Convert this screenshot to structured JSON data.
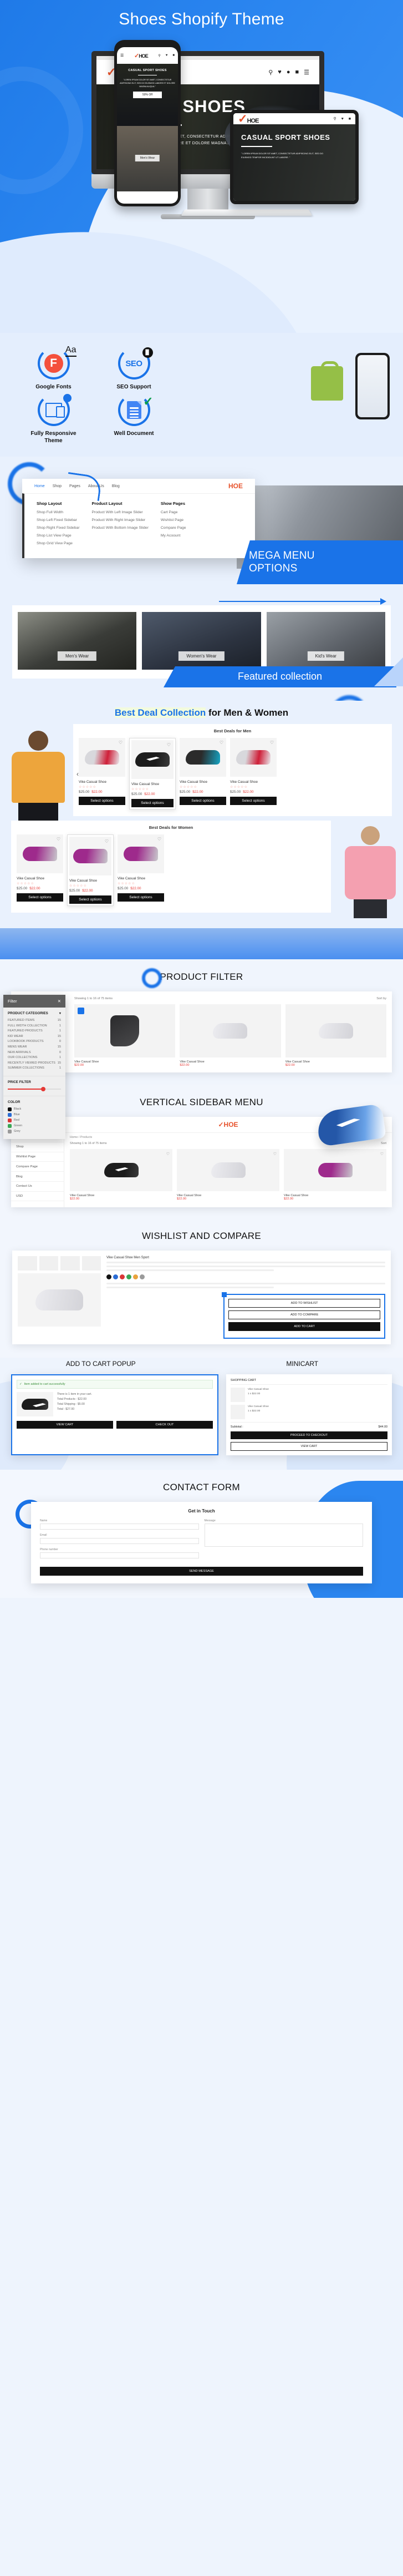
{
  "hero": {
    "title": "Shoes Shopify Theme",
    "desktop": {
      "logo": "HOE",
      "banner_title": "SPORT SHOES",
      "banner_text": "\" LOREM IPSUM DOLOR SIT AMET, CONSECTETUR ADIPISCING ELIT, SED DO EIUSMOD TEMPOR INCIDIDUNT UT LABORE ET DOLORE MAGNA ALIQUA. \"",
      "icons": [
        "search-icon",
        "heart-icon",
        "user-icon",
        "cart-icon",
        "menu-icon"
      ]
    },
    "phone": {
      "banner_title": "CASUAL SPORT SHOES",
      "banner_text": "\"LOREM IPSUM DOLOR SIT AMET, CONSECTETUR ADIPISCING ELIT, SED DO EIUSMOD LABORE ET DOLORE MAGNA ALIQUA.\"",
      "offer": "50% Off",
      "category_tag": "Men's Wear"
    },
    "tablet": {
      "banner_title": "CASUAL SPORT SHOES",
      "banner_text": "\" LOREM IPSUM DOLOR SIT AMET, CONSECTETUR ADIPISCING ELIT, SED DO EIUSMOD TEMPOR INCIDIDUNT UT LABORE. \""
    }
  },
  "features": {
    "items": [
      {
        "label": "Google Fonts",
        "icon": "google-fonts-icon",
        "glyph": "F",
        "aa": "Aa"
      },
      {
        "label": "SEO Support",
        "icon": "seo-icon",
        "glyph": "SEO",
        "badge": "chart-badge-icon"
      },
      {
        "label": "Fully Responsive\nTheme",
        "icon": "responsive-devices-icon"
      },
      {
        "label": "Well Document",
        "icon": "document-check-icon"
      }
    ],
    "shopify_logo": "shopify-bag-icon"
  },
  "mega_menu": {
    "nav": [
      "Home",
      "Shop",
      "Pages",
      "About Us",
      "Blog"
    ],
    "logo": "HOE",
    "columns": [
      {
        "heading": "Shop Layout",
        "links": [
          "Shop Full Width",
          "Shop Left Fixed Sidebar",
          "Shop Right Fixed Sidebar",
          "Shop List View Page",
          "Shop Grid View Page"
        ]
      },
      {
        "heading": "Product Layout",
        "links": [
          "Product With Left Image Slider",
          "Product With Right Image Slider",
          "Product With Bottom Image Slider"
        ]
      },
      {
        "heading": "Show Pages",
        "links": [
          "Cart Page",
          "Wishlist Page",
          "Compare Page",
          "My Acoount"
        ]
      }
    ],
    "label": "MEGA MENU\nOPTIONS"
  },
  "featured_collection": {
    "cells": [
      {
        "tag": "Men's Wear"
      },
      {
        "tag": "Women's Wear"
      },
      {
        "tag": "Kid's Wear"
      }
    ],
    "banner": "Featured collection"
  },
  "best_deal": {
    "title_highlight": "Best Deal Collection",
    "title_rest": " for Men & Women",
    "men": {
      "heading": "Best Deals for Men",
      "products": [
        {
          "name": "Vike Casual Shoe",
          "stars": "☆☆☆☆☆",
          "price": "$25.00",
          "sale": "$22.00",
          "button": "Select options"
        },
        {
          "name": "Vike Casual Shoe",
          "stars": "☆☆☆☆☆",
          "price": "$25.00",
          "sale": "$22.00",
          "button": "Select options"
        },
        {
          "name": "Vike Casual Shoe",
          "stars": "☆☆☆☆☆",
          "price": "$25.00",
          "sale": "$22.00",
          "button": "Select options"
        },
        {
          "name": "Vike Casual Shoe",
          "stars": "☆☆☆☆☆",
          "price": "$25.00",
          "sale": "$22.00",
          "button": "Select options"
        }
      ]
    },
    "women": {
      "heading": "Best Deals for Women",
      "products": [
        {
          "name": "Vike Casual Shoe",
          "stars": "☆☆☆☆☆",
          "price": "$25.00",
          "sale": "$22.00",
          "button": "Select options"
        },
        {
          "name": "Vike Casual Shoe",
          "stars": "☆☆☆☆☆",
          "price": "$25.00",
          "sale": "$22.00",
          "button": "Select options"
        },
        {
          "name": "Vike Casual Shoe",
          "stars": "☆☆☆☆☆",
          "price": "$25.00",
          "sale": "$22.00",
          "button": "Select options"
        }
      ]
    }
  },
  "product_filter": {
    "section_title": "PRODUCT FILTER",
    "panel_title": "Filter",
    "close_icon": "close-icon",
    "categories_heading": "PRODUCT CATEGORIES",
    "categories": [
      {
        "label": "FEATURED ITEMS",
        "count": "15"
      },
      {
        "label": "FULL WIDTH COLLECTION",
        "count": "1"
      },
      {
        "label": "FEATURED PRODUCTS",
        "count": "1"
      },
      {
        "label": "KID WEAR",
        "count": "15"
      },
      {
        "label": "LOOKBOOK PRODUCTS",
        "count": "0"
      },
      {
        "label": "MENS WEAR",
        "count": "15"
      },
      {
        "label": "NEW ARRIVALS",
        "count": "0"
      },
      {
        "label": "OUR COLLECTIONS",
        "count": "1"
      },
      {
        "label": "RECENTLY VIEWED PRODUCTS",
        "count": "15"
      },
      {
        "label": "SUMMER COLLECTIONS",
        "count": "1"
      }
    ],
    "price_heading": "PRICE FILTER",
    "color_heading": "COLOR",
    "colors": [
      {
        "name": "Black",
        "hex": "#111111"
      },
      {
        "name": "Blue",
        "hex": "#2b6cd4"
      },
      {
        "name": "Red",
        "hex": "#d93636"
      },
      {
        "name": "Green",
        "hex": "#3aa655"
      },
      {
        "name": "Grey",
        "hex": "#9a9a9a"
      }
    ],
    "showing_text": "Showing 1 to 16 of 75 items",
    "sort_label": "Sort by",
    "products": [
      {
        "name": "Vike Casual Shoe",
        "price": "$22.00"
      },
      {
        "name": "Vike Casual Shoe",
        "price": "$22.00"
      },
      {
        "name": "Vike Casual Shoe",
        "price": "$22.00"
      }
    ]
  },
  "vertical_sidebar": {
    "section_title": "VERTICAL SIDEBAR MENU",
    "logo": "HOE",
    "currency": "USD",
    "menu": [
      "Home",
      "Shop",
      "Wishlist Page",
      "Compare Page",
      "Blog",
      "Contact Us",
      "USD"
    ],
    "breadcrumb": "Home  /  Products",
    "showing_text": "Showing 1 to 16 of 75 items",
    "sort_label": "Sort by",
    "sort_value": "Sort",
    "products": [
      {
        "name": "Vike Casual Shoe",
        "price": "$22.00"
      },
      {
        "name": "Vike Casual Shoe",
        "price": "$22.00"
      },
      {
        "name": "Vike Casual Shoe",
        "price": "$22.00"
      }
    ]
  },
  "wishlist_compare": {
    "section_title": "WISHLIST AND COMPARE",
    "product_title": "Vike Casual Shoe Men Sport",
    "buttons": [
      "ADD TO WISHLIST",
      "ADD TO COMPARE",
      "ADD TO CART"
    ],
    "swatches": [
      "#111111",
      "#2b6cd4",
      "#d93636",
      "#3aa655",
      "#e8a33d",
      "#9a9a9a"
    ]
  },
  "cart": {
    "popup_title": "ADD TO CART POPUP",
    "minicart_title": "MINICART",
    "popup": {
      "success_text": "Item added to cart successfully",
      "product_name": "Vike Casual Shoe",
      "meta": "There is 1 item in your cart.\nTotal Products : $22.00\nTotal Shipping : $5.00\nTotal : $27.00",
      "buttons": [
        "VIEW CART",
        "CHECK OUT"
      ]
    },
    "minicart": {
      "header": "SHOPPING CART",
      "items": [
        {
          "name": "Vike Casual Shoe",
          "meta": "1 x $22.00"
        },
        {
          "name": "Vike Casual Shoe",
          "meta": "1 x $22.00"
        }
      ],
      "subtotal_label": "Subtotal :",
      "subtotal_value": "$44.00",
      "buttons": [
        "PROCEED TO CHECKOUT",
        "VIEW CART"
      ]
    }
  },
  "contact": {
    "section_title": "CONTACT FORM",
    "heading": "Get in Touch",
    "fields": [
      {
        "label": "Name",
        "placeholder": ""
      },
      {
        "label": "Email",
        "placeholder": ""
      },
      {
        "label": "Phone number",
        "placeholder": ""
      },
      {
        "label": "Message",
        "placeholder": ""
      }
    ],
    "submit": "SEND MESSAGE"
  },
  "colors": {
    "brand_blue": "#1a73e8",
    "hero_blue": "#2b86f0",
    "bg_light": "#e9f1fd",
    "accent_red": "#e53935",
    "orange": "#e7522b"
  }
}
